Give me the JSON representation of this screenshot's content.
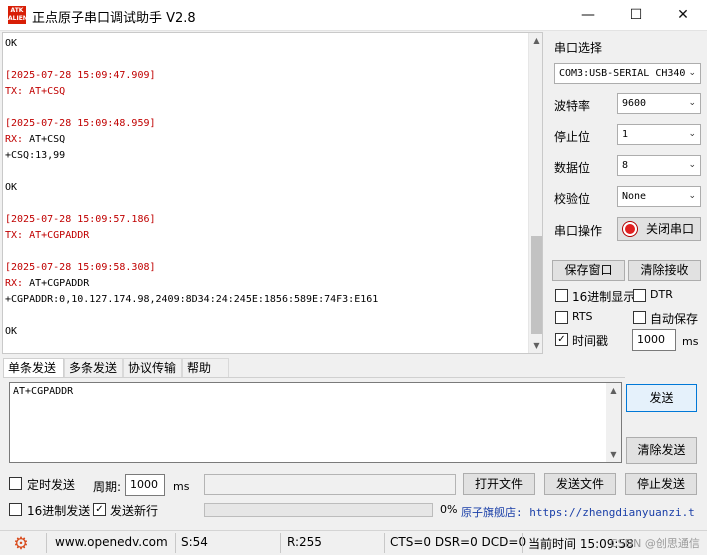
{
  "window": {
    "logo_text": "ATK ALIENTEK",
    "title": "正点原子串口调试助手 V2.8",
    "minimize": "—",
    "maximize": "☐",
    "close": "✕"
  },
  "receive": {
    "lines": [
      {
        "text": "OK",
        "color": "black"
      },
      {
        "text": "",
        "color": "black"
      },
      {
        "text": "[2025-07-28 15:09:47.909]",
        "color": "red"
      },
      {
        "text": "TX: AT+CSQ",
        "color": "red"
      },
      {
        "text": "",
        "color": "black"
      },
      {
        "text": "[2025-07-28 15:09:48.959]",
        "color": "red"
      },
      {
        "text": "RX: AT+CSQ",
        "color": "mixed"
      },
      {
        "text": "+CSQ:13,99",
        "color": "black"
      },
      {
        "text": "",
        "color": "black"
      },
      {
        "text": "OK",
        "color": "black"
      },
      {
        "text": "",
        "color": "black"
      },
      {
        "text": "[2025-07-28 15:09:57.186]",
        "color": "red"
      },
      {
        "text": "TX: AT+CGPADDR",
        "color": "red"
      },
      {
        "text": "",
        "color": "black"
      },
      {
        "text": "[2025-07-28 15:09:58.308]",
        "color": "red"
      },
      {
        "text": "RX: AT+CGPADDR",
        "color": "mixed"
      },
      {
        "text": "+CGPADDR:0,10.127.174.98,2409:8D34:24:245E:1856:589E:74F3:E161",
        "color": "black"
      },
      {
        "text": "",
        "color": "black"
      },
      {
        "text": "OK",
        "color": "black"
      }
    ],
    "colors": {
      "red": "#c00000",
      "black": "#000000"
    }
  },
  "panel": {
    "port_select_label": "串口选择",
    "port_value": "COM3:USB-SERIAL CH340",
    "baud_label": "波特率",
    "baud_value": "9600",
    "stopbits_label": "停止位",
    "stopbits_value": "1",
    "databits_label": "数据位",
    "databits_value": "8",
    "parity_label": "校验位",
    "parity_value": "None",
    "port_op_label": "串口操作",
    "close_port_button": "关闭串口",
    "save_window_button": "保存窗口",
    "clear_receive_button": "清除接收",
    "hex_display_label": "16进制显示",
    "dtr_label": "DTR",
    "rts_label": "RTS",
    "auto_save_label": "自动保存",
    "timestamp_label": "时间戳",
    "timestamp_value": "1000",
    "timestamp_unit": "ms",
    "hex_display_checked": false,
    "dtr_checked": false,
    "rts_checked": false,
    "auto_save_checked": false,
    "timestamp_checked": true
  },
  "tabs": [
    {
      "label": "单条发送",
      "active": true
    },
    {
      "label": "多条发送",
      "active": false
    },
    {
      "label": "协议传输",
      "active": false
    },
    {
      "label": "帮助",
      "active": false
    }
  ],
  "send": {
    "text": "AT+CGPADDR",
    "send_button": "发送",
    "clear_send_button": "清除发送",
    "timed_send_label": "定时发送",
    "period_label": "周期:",
    "period_value": "1000",
    "period_unit": "ms",
    "open_file_button": "打开文件",
    "send_file_button": "发送文件",
    "stop_send_button": "停止发送",
    "hex_send_label": "16进制发送",
    "send_newline_label": "发送新行",
    "progress_text": "0%",
    "progress_fraction": 0,
    "timed_send_checked": false,
    "hex_send_checked": false,
    "send_newline_checked": true,
    "link_text": "原子旗舰店: https://zhengdianyuanzi.t"
  },
  "status": {
    "website": "www.openedv.com",
    "s_count": "S:54",
    "r_count": "R:255",
    "signals": "CTS=0 DSR=0 DCD=0",
    "time_label": "当前时间 15:09:58",
    "watermark": "CSDN @创思通信"
  }
}
